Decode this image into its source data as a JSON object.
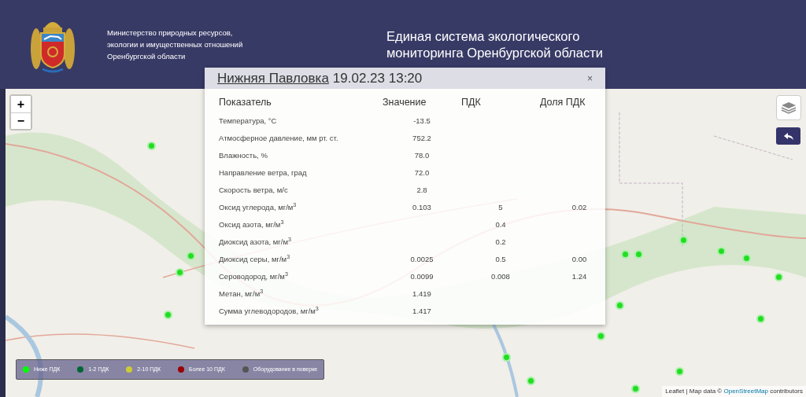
{
  "header": {
    "ministry": [
      "Министерство природных ресурсов,",
      "экологии и имущественных отношений",
      "Оренбургской области"
    ],
    "title": [
      "Единая система экологического",
      "мониторинга Оренбургской области"
    ]
  },
  "map_controls": {
    "zoom_in": "+",
    "zoom_out": "−"
  },
  "popup": {
    "station": "Нижняя Павловка",
    "datetime": "19.02.23 13:20",
    "close": "×",
    "columns": [
      "Показатель",
      "Значение",
      "ПДК",
      "Доля ПДК"
    ],
    "rows": [
      {
        "name": "Температура, °С",
        "value": "-13.5",
        "pdk": "",
        "share": ""
      },
      {
        "name": "Атмосферное давление, мм рт. ст.",
        "value": "752.2",
        "pdk": "",
        "share": ""
      },
      {
        "name": "Влажность, %",
        "value": "78.0",
        "pdk": "",
        "share": ""
      },
      {
        "name": "Направление ветра, град",
        "value": "72.0",
        "pdk": "",
        "share": ""
      },
      {
        "name": "Скорость ветра, м/с",
        "value": "2.8",
        "pdk": "",
        "share": ""
      },
      {
        "name": "Оксид углерода, мг/м$^{3}$",
        "value": "0.103",
        "pdk": "5",
        "share": "0.02"
      },
      {
        "name": "Оксид азота, мг/м$^{3}$",
        "value": "",
        "pdk": "0.4",
        "share": ""
      },
      {
        "name": "Диоксид азота, мг/м$^{3}$",
        "value": "",
        "pdk": "0.2",
        "share": ""
      },
      {
        "name": "Диоксид серы, мг/м$^{3}$",
        "value": "0.0025",
        "pdk": "0.5",
        "share": "0.00"
      },
      {
        "name": "Сероводород, мг/м$^{3}$",
        "value": "0.0099",
        "pdk": "0.008",
        "share": "1.24"
      },
      {
        "name": "Метан, мг/м$^{3}$",
        "value": "1.419",
        "pdk": "",
        "share": ""
      },
      {
        "name": "Сумма углеводородов, мг/м$^{3}$",
        "value": "1.417",
        "pdk": "",
        "share": ""
      }
    ]
  },
  "markers": [
    {
      "color": "#22dd22"
    },
    {
      "color": "#22dd22"
    },
    {
      "color": "#22dd22"
    },
    {
      "color": "#22dd22"
    },
    {
      "color": "#22dd22"
    },
    {
      "color": "#22dd22"
    },
    {
      "color": "#22dd22"
    },
    {
      "color": "#22dd22"
    },
    {
      "color": "#22dd22"
    },
    {
      "color": "#22dd22"
    },
    {
      "color": "#22dd22"
    },
    {
      "color": "#22dd22"
    },
    {
      "color": "#22dd22"
    },
    {
      "color": "#22dd22"
    },
    {
      "color": "#22dd22"
    },
    {
      "color": "#22dd22"
    },
    {
      "color": "#22dd22"
    }
  ],
  "legend": [
    {
      "label": "Ниже ПДК",
      "color": "#00ff00"
    },
    {
      "label": "1-2 ПДК",
      "color": "#006633"
    },
    {
      "label": "2-10 ПДК",
      "color": "#cccc33"
    },
    {
      "label": "Более 10 ПДК",
      "color": "#990000"
    },
    {
      "label": "Оборудование в поверке",
      "color": "#555555"
    }
  ],
  "attribution": {
    "prefix": "Leaflet | Map data ©",
    "link": "OpenStreetMap",
    "suffix": "contributors"
  }
}
